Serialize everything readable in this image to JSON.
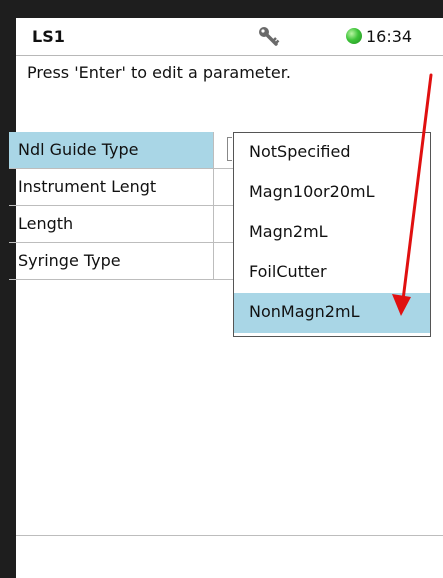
{
  "header": {
    "title": "LS1",
    "time": "16:34",
    "key_icon": "key-icon",
    "status_icon": "status-led-green"
  },
  "message": "Press 'Enter' to edit a parameter.",
  "parameters": [
    {
      "label": "Ndl Guide Type",
      "selected": true
    },
    {
      "label": "Instrument Lengt",
      "selected": false
    },
    {
      "label": "Length",
      "selected": false
    },
    {
      "label": "Syringe Type",
      "selected": false
    }
  ],
  "dropdown": {
    "options": [
      "NotSpecified",
      "Magn10or20mL",
      "Magn2mL",
      "FoilCutter",
      "NonMagn2mL"
    ],
    "highlighted": "NonMagn2mL"
  },
  "colors": {
    "selection": "#a9d6e6",
    "arrow": "#e01010",
    "led": "#3fc43a"
  }
}
